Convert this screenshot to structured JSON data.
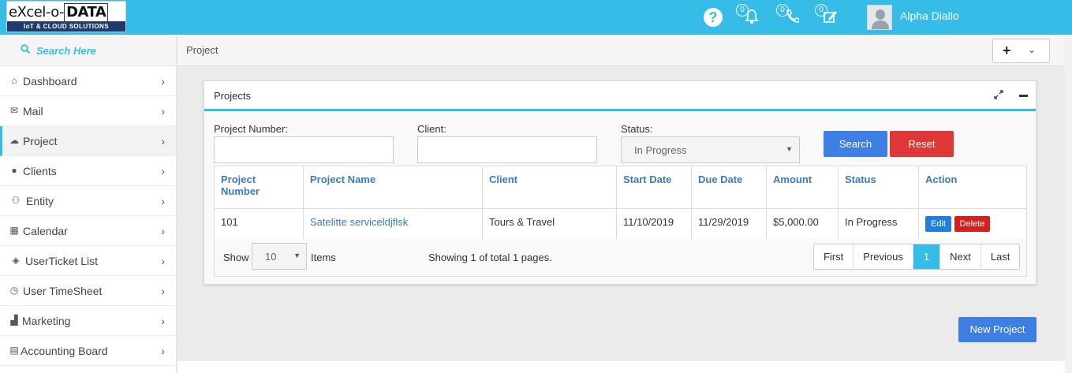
{
  "brand": {
    "logo_text_prefix": "eXcel-o-",
    "logo_text_data": "DATA",
    "logo_tagline": "IoT & CLOUD SOLUTIONS"
  },
  "topbar": {
    "notifications_count": "0",
    "calls_count": "0",
    "tasks_count": "0",
    "user_name": "Alpha Diallo",
    "accent_color": "#35bde7"
  },
  "sidebar": {
    "search_label": "Search Here",
    "items": [
      {
        "label": "Dashboard",
        "icon": "home-icon"
      },
      {
        "label": "Mail",
        "icon": "envelope-icon"
      },
      {
        "label": "Project",
        "icon": "cloud-icon"
      },
      {
        "label": "Clients",
        "icon": "user-icon"
      },
      {
        "label": "Entity",
        "icon": "users-icon"
      },
      {
        "label": "Calendar",
        "icon": "calendar-icon"
      },
      {
        "label": "UserTicket List",
        "icon": "ticket-icon"
      },
      {
        "label": "User TimeSheet",
        "icon": "clock-icon"
      },
      {
        "label": "Marketing",
        "icon": "bar-chart-icon"
      },
      {
        "label": "Accounting Board",
        "icon": "calculator-icon"
      }
    ],
    "active": "Project"
  },
  "breadcrumb": "Project",
  "panel": {
    "title": "Projects",
    "filters": {
      "project_number_label": "Project Number:",
      "client_label": "Client:",
      "status_label": "Status:",
      "status_value": "In Progress",
      "search_button": "Search",
      "reset_button": "Reset"
    },
    "table": {
      "headers": [
        "Project Number",
        "Project Name",
        "Client",
        "Start Date",
        "Due Date",
        "Amount",
        "Status",
        "Action"
      ],
      "rows": [
        {
          "project_number": "101",
          "project_name": "Satelitte serviceldjflsk",
          "client": "Tours & Travel",
          "start_date": "11/10/2019",
          "due_date": "11/29/2019",
          "amount": "$5,000.00",
          "status": "In Progress",
          "edit_label": "Edit",
          "delete_label": "Delete"
        }
      ]
    },
    "footer": {
      "show_label": "Show",
      "page_size": "10",
      "items_label": "Items",
      "showing_text": "Showing 1 of total 1 pages.",
      "pager": {
        "first": "First",
        "previous": "Previous",
        "current": "1",
        "next": "Next",
        "last": "Last"
      }
    }
  },
  "new_project_button": "New Project"
}
